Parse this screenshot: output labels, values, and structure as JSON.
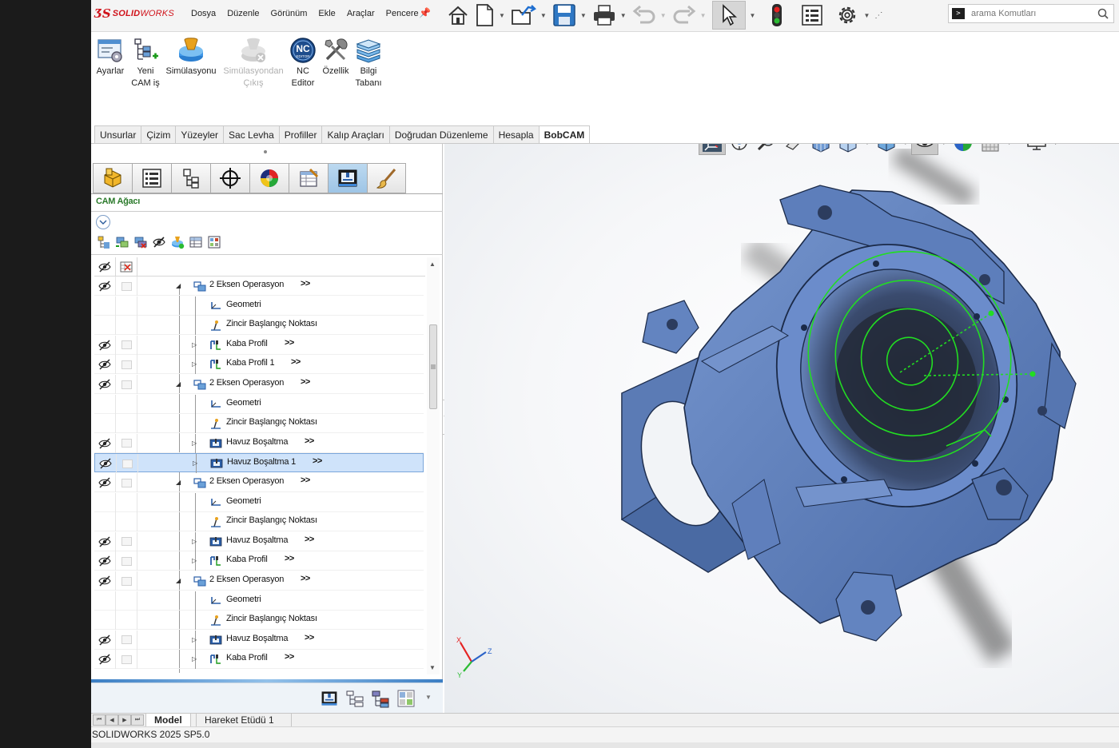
{
  "app": {
    "logo_mark": "ƷS",
    "logo_solid": "SOLID",
    "logo_works": "WORKS"
  },
  "menu": [
    "Dosya",
    "Düzenle",
    "Görünüm",
    "Ekle",
    "Araçlar",
    "Pencere"
  ],
  "search": {
    "placeholder": "arama Komutları",
    "prompt": ">"
  },
  "ribbon": {
    "buttons": [
      {
        "label1": "Ayarlar",
        "label2": ""
      },
      {
        "label1": "Yeni",
        "label2": "CAM iş"
      },
      {
        "label1": "Simülasyonu",
        "label2": ""
      },
      {
        "label1": "Simülasyondan",
        "label2": "Çıkış"
      },
      {
        "label1": "NC",
        "label2": "Editor"
      },
      {
        "label1": "Özellik",
        "label2": ""
      },
      {
        "label1": "Bilgi",
        "label2": "Tabanı"
      }
    ],
    "nc_icon_text": "NC",
    "nc_icon_sub": "EDITOR"
  },
  "tabs": [
    "Unsurlar",
    "Çizim",
    "Yüzeyler",
    "Sac Levha",
    "Profiller",
    "Kalıp Araçları",
    "Doğrudan Düzenleme",
    "Hesapla",
    "BobCAM"
  ],
  "tabs_active_index": 8,
  "panel": {
    "title": "CAM Ağacı"
  },
  "tree": {
    "rows": [
      {
        "level": 0,
        "label": "2 Eksen Operasyon",
        "icon": "operation-icon",
        "has_eye": true,
        "arrows": ">>",
        "selected": false
      },
      {
        "level": 1,
        "label": "Geometri",
        "icon": "geometry-icon",
        "has_eye": false,
        "arrows": "",
        "selected": false
      },
      {
        "level": 1,
        "label": "Zincir Başlangıç Noktası",
        "icon": "chain-start-icon",
        "has_eye": false,
        "arrows": "",
        "selected": false
      },
      {
        "level": 1,
        "label": "Kaba Profil",
        "icon": "rough-profile-icon",
        "has_eye": true,
        "arrows": ">>",
        "selected": false
      },
      {
        "level": 1,
        "label": "Kaba Profil 1",
        "icon": "rough-profile-icon",
        "has_eye": true,
        "arrows": ">>",
        "selected": false
      },
      {
        "level": 0,
        "label": "2 Eksen Operasyon",
        "icon": "operation-icon",
        "has_eye": true,
        "arrows": ">>",
        "selected": false
      },
      {
        "level": 1,
        "label": "Geometri",
        "icon": "geometry-icon",
        "has_eye": false,
        "arrows": "",
        "selected": false
      },
      {
        "level": 1,
        "label": "Zincir Başlangıç Noktası",
        "icon": "chain-start-icon",
        "has_eye": false,
        "arrows": "",
        "selected": false
      },
      {
        "level": 1,
        "label": "Havuz Boşaltma",
        "icon": "pocket-icon",
        "has_eye": true,
        "arrows": ">>",
        "selected": false
      },
      {
        "level": 1,
        "label": "Havuz Boşaltma 1",
        "icon": "pocket-icon",
        "has_eye": true,
        "arrows": ">>",
        "selected": true
      },
      {
        "level": 0,
        "label": "2 Eksen Operasyon",
        "icon": "operation-icon",
        "has_eye": true,
        "arrows": ">>",
        "selected": false
      },
      {
        "level": 1,
        "label": "Geometri",
        "icon": "geometry-icon",
        "has_eye": false,
        "arrows": "",
        "selected": false
      },
      {
        "level": 1,
        "label": "Zincir Başlangıç Noktası",
        "icon": "chain-start-icon",
        "has_eye": false,
        "arrows": "",
        "selected": false
      },
      {
        "level": 1,
        "label": "Havuz Boşaltma",
        "icon": "pocket-icon",
        "has_eye": true,
        "arrows": ">>",
        "selected": false
      },
      {
        "level": 1,
        "label": "Kaba Profil",
        "icon": "rough-profile-icon",
        "has_eye": true,
        "arrows": ">>",
        "selected": false
      },
      {
        "level": 0,
        "label": "2 Eksen Operasyon",
        "icon": "operation-icon",
        "has_eye": true,
        "arrows": ">>",
        "selected": false
      },
      {
        "level": 1,
        "label": "Geometri",
        "icon": "geometry-icon",
        "has_eye": false,
        "arrows": "",
        "selected": false
      },
      {
        "level": 1,
        "label": "Zincir Başlangıç Noktası",
        "icon": "chain-start-icon",
        "has_eye": false,
        "arrows": "",
        "selected": false
      },
      {
        "level": 1,
        "label": "Havuz Boşaltma",
        "icon": "pocket-icon",
        "has_eye": true,
        "arrows": ">>",
        "selected": false
      },
      {
        "level": 1,
        "label": "Kaba Profil",
        "icon": "rough-profile-icon",
        "has_eye": true,
        "arrows": ">>",
        "selected": false
      }
    ]
  },
  "triad": {
    "x": "X",
    "y": "Y",
    "z": "Z"
  },
  "model_tabs": [
    "Model",
    "Hareket Etüdü 1"
  ],
  "status": {
    "version": "SOLIDWORKS 2025 SP5.0"
  },
  "colors": {
    "part": "#5b7bb5",
    "toolpath": "#22dd22",
    "brand": "#d0131b"
  }
}
